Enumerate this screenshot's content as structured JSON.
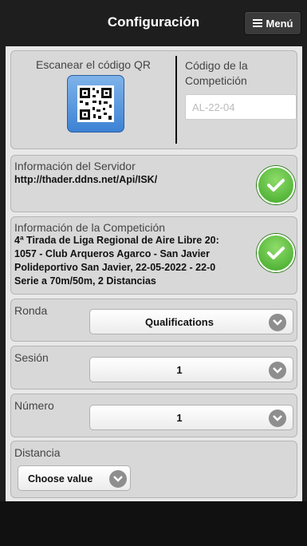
{
  "header": {
    "title": "Configuración",
    "menu_label": "Menú"
  },
  "qr": {
    "scan_label": "Escanear el código QR",
    "competition_code_label": "Código de la Competición",
    "competition_code_placeholder": "AL-22-04"
  },
  "server": {
    "label": "Información del Servidor",
    "url": "http://thader.ddns.net/Api/ISK/",
    "status_icon": "check-icon"
  },
  "competition": {
    "label": "Información de la Competición",
    "lines": [
      "4ª Tirada de Liga Regional de Aire Libre 20:",
      "1057 - Club Arqueros Agarco - San Javier",
      "Polideportivo San Javier, 22-05-2022 - 22-0",
      "Serie a 70m/50m, 2 Distancias"
    ],
    "status_icon": "check-icon"
  },
  "fields": {
    "ronda": {
      "label": "Ronda",
      "value": "Qualifications"
    },
    "sesion": {
      "label": "Sesión",
      "value": "1"
    },
    "numero": {
      "label": "Número",
      "value": "1"
    },
    "distancia": {
      "label": "Distancia",
      "value": "Choose value"
    }
  },
  "colors": {
    "accent_green": "#4cb52f",
    "qr_button_blue": "#4a8fe0",
    "header_bg": "#1e1e1e"
  }
}
